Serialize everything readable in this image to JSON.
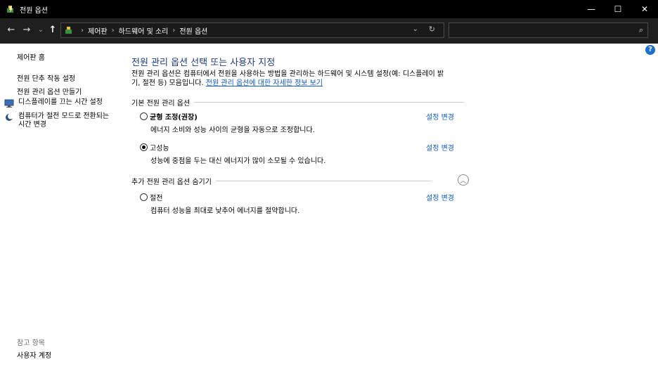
{
  "window": {
    "title": "전원 옵션",
    "minimize": "—",
    "maximize": "☐",
    "close": "✕"
  },
  "nav": {
    "back": "←",
    "forward": "→",
    "recent": "⌄",
    "up": "↑"
  },
  "address": {
    "crumbs": [
      "제어판",
      "하드웨어 및 소리",
      "전원 옵션"
    ],
    "separator": "›",
    "dropdown": "⌄",
    "refresh": "↻"
  },
  "search": {
    "placeholder": "",
    "icon": "search-icon",
    "glyph": "⌕"
  },
  "help": {
    "label": "?"
  },
  "sidebar": {
    "home": "제어판 홈",
    "links": [
      "전원 단추 작동 설정",
      "전원 관리 옵션 만들기"
    ],
    "items": [
      {
        "label": "디스플레이를 끄는 시간 설정",
        "icon": "monitor-icon"
      },
      {
        "label": "컴퓨터가 절전 모드로 전환되는 시간 변경",
        "icon": "moon-icon"
      }
    ],
    "see_also": "참고 항목",
    "user_accounts": "사용자 계정"
  },
  "main": {
    "title": "전원 관리 옵션 선택 또는 사용자 지정",
    "description": "전원 관리 옵션은 컴퓨터에서 전원을 사용하는 방법을 관리하는 하드웨어 및 시스템 설정(예: 디스플레이 밝기, 절전 등) 모음입니다.",
    "description_line1": "전원 관리 옵션은 컴퓨터에서 전원을 사용하는 방법을 관리하는 하드웨어 및 시스템 설정(예: 디스플레이 밝",
    "description_line2": "기, 절전 등) 모음입니다.",
    "learn_more": "전원 관리 옵션에 대한 자세한 정보 보기",
    "basic_section": "기본 전원 관리 옵션",
    "more_section": "추가 전원 관리 옵션 숨기기",
    "collapse_glyph": "︿",
    "change_label": "설정 변경",
    "plans": [
      {
        "name": "균형 조정(권장)",
        "desc": "에너지 소비와 성능 사이의 균형을 자동으로 조정합니다.",
        "selected": false,
        "bold": true
      },
      {
        "name": "고성능",
        "desc": "성능에 중점을 두는 대신 에너지가 많이 소모될 수 있습니다.",
        "selected": true,
        "bold": false
      },
      {
        "name": "절전",
        "desc": "컴퓨터 성능을 최대로 낮추어 에너지를 절약합니다.",
        "selected": false,
        "bold": false
      }
    ]
  },
  "colors": {
    "link": "#0b5bd7",
    "title": "#1e3a8a",
    "help": "#1a6fd0",
    "chrome": "#000000"
  }
}
